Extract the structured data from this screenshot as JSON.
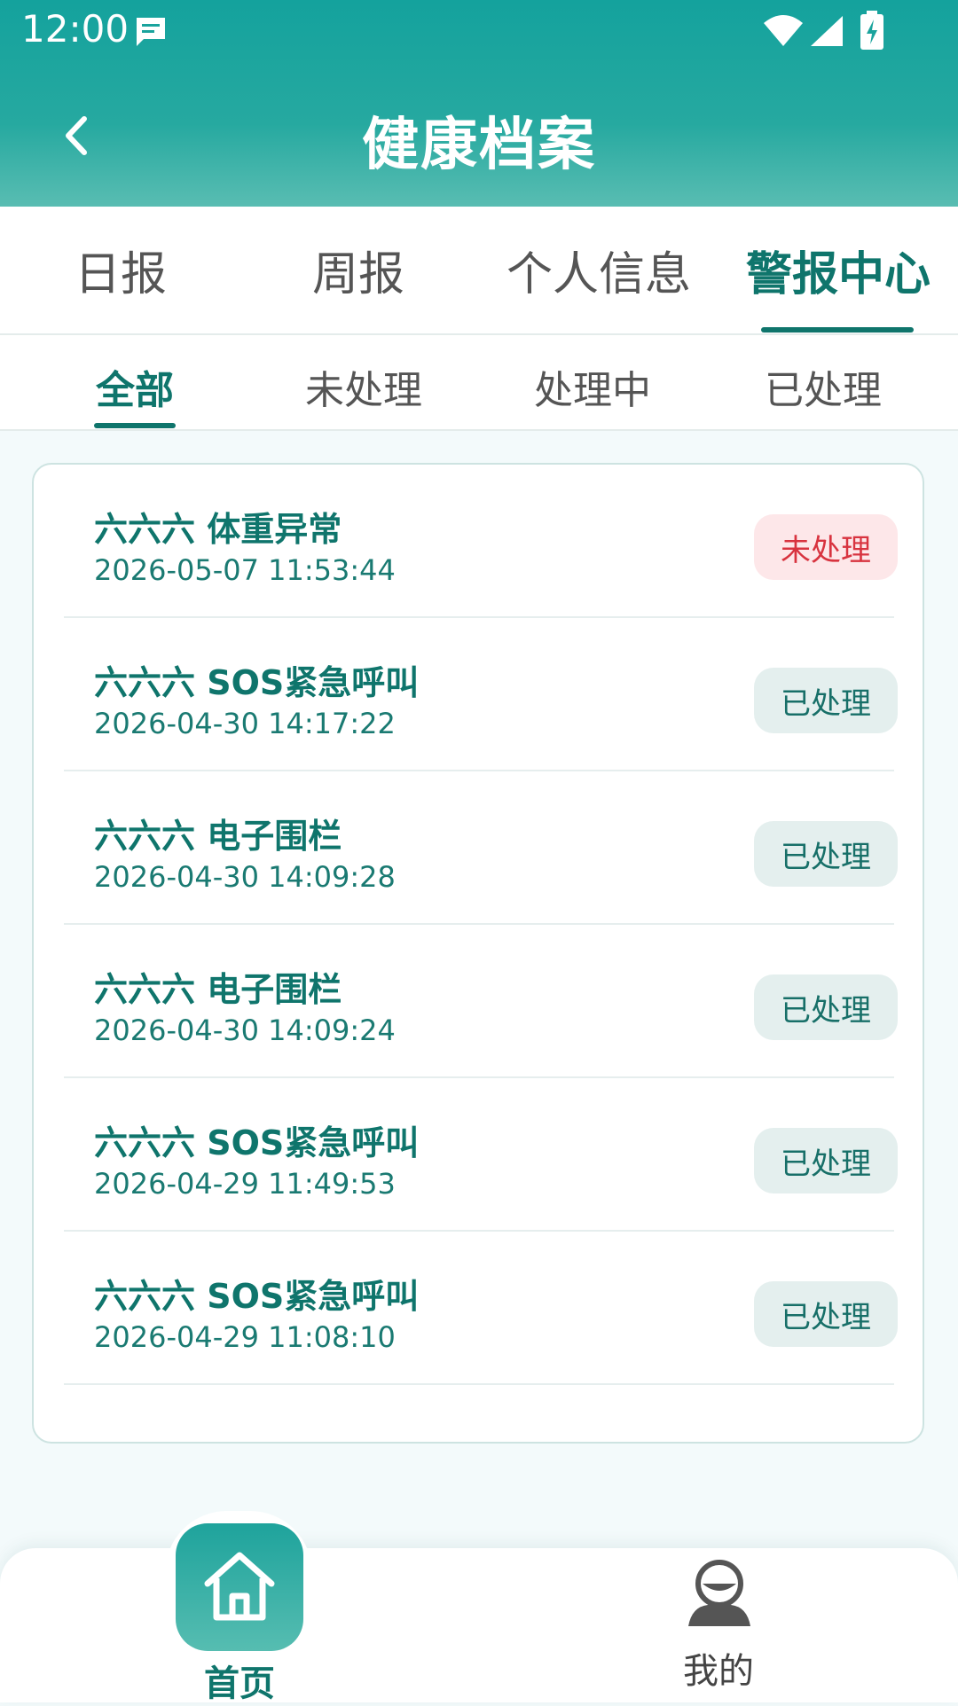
{
  "status_bar": {
    "time": "12:00",
    "icons": [
      "message-icon",
      "wifi-icon",
      "signal-icon",
      "battery-charging-icon"
    ]
  },
  "header": {
    "title": "健康档案",
    "back_icon": "chevron-left-icon"
  },
  "main_tabs": [
    {
      "label": "日报",
      "active": false
    },
    {
      "label": "周报",
      "active": false
    },
    {
      "label": "个人信息",
      "active": false
    },
    {
      "label": "警报中心",
      "active": true
    }
  ],
  "sub_tabs": [
    {
      "label": "全部",
      "active": true
    },
    {
      "label": "未处理",
      "active": false
    },
    {
      "label": "处理中",
      "active": false
    },
    {
      "label": "已处理",
      "active": false
    }
  ],
  "alarms": [
    {
      "title": "六六六 体重异常",
      "time": "2026-05-07 11:53:44",
      "status": "未处理"
    },
    {
      "title": "六六六 SOS紧急呼叫",
      "time": "2026-04-30 14:17:22",
      "status": "已处理"
    },
    {
      "title": "六六六 电子围栏",
      "time": "2026-04-30 14:09:28",
      "status": "已处理"
    },
    {
      "title": "六六六 电子围栏",
      "time": "2026-04-30 14:09:24",
      "status": "已处理"
    },
    {
      "title": "六六六 SOS紧急呼叫",
      "time": "2026-04-29 11:49:53",
      "status": "已处理"
    },
    {
      "title": "六六六 SOS紧急呼叫",
      "time": "2026-04-29 11:08:10",
      "status": "已处理"
    }
  ],
  "bottom_nav": {
    "home_label": "首页",
    "mine_label": "我的",
    "home_icon": "home-icon",
    "mine_icon": "user-avatar-icon"
  },
  "colors": {
    "primary": "#0f756c",
    "header_gradient_top": "#14a29d",
    "header_gradient_bottom": "#59bdb2",
    "badge_unprocessed_bg": "#fde7e9",
    "badge_unprocessed_text": "#d8333f",
    "badge_processed_bg": "#e4efee",
    "badge_processed_text": "#176f68"
  }
}
